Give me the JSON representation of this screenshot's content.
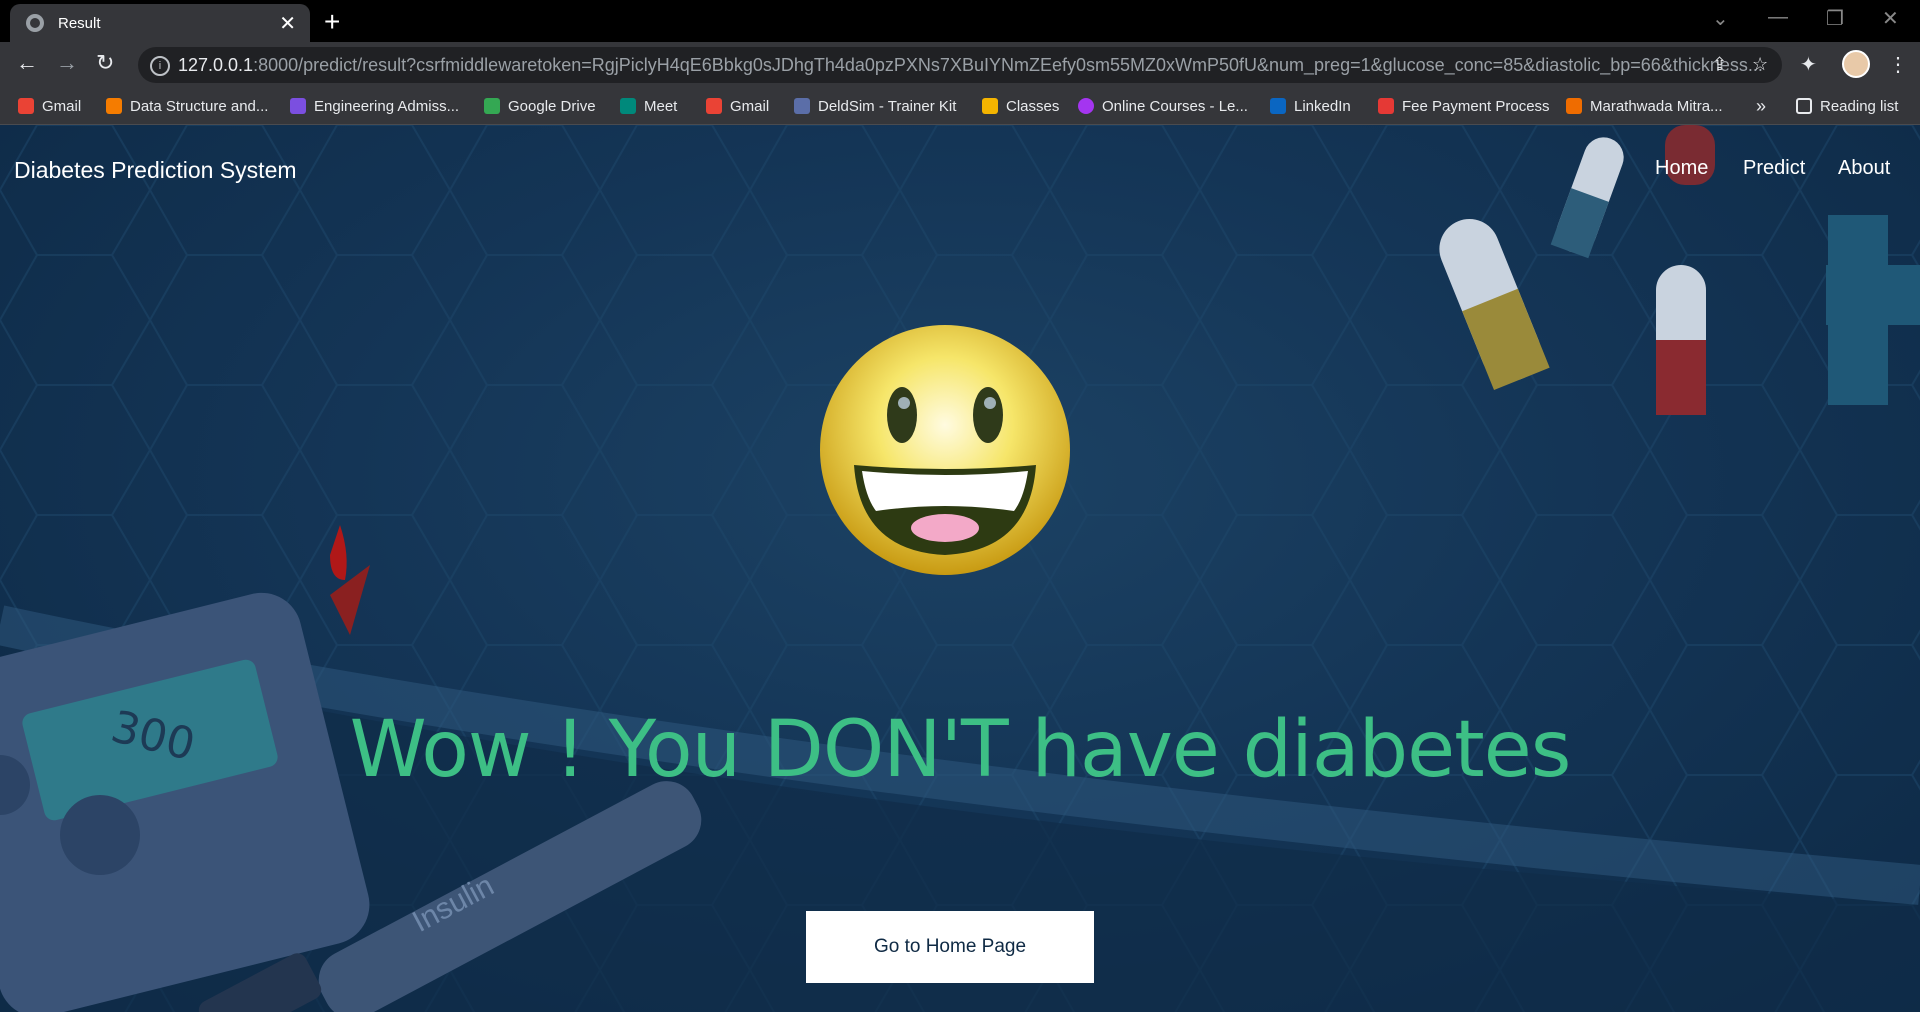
{
  "browser": {
    "tab_title": "Result",
    "url_host": "127.0.0.1",
    "url_path": ":8000/predict/result?csrfmiddlewaretoken=RgjPiclyH4qE6Bbkg0sJDhgTh4da0pzPXNs7XBuIYNmZEefy0sm55MZ0xWmP50fU&num_preg=1&glucose_conc=85&diastolic_bp=66&thickness...",
    "new_tab_symbol": "+",
    "close_symbol": "✕"
  },
  "bookmarks": [
    {
      "label": "Gmail",
      "icon": "gmail-icon",
      "color": "#ea4335"
    },
    {
      "label": "Data Structure and...",
      "icon": "blogger-icon",
      "color": "#f57c00"
    },
    {
      "label": "Engineering Admiss...",
      "icon": "list-icon",
      "color": "#7b4fe0"
    },
    {
      "label": "Google Drive",
      "icon": "drive-icon",
      "color": "#34a853"
    },
    {
      "label": "Meet",
      "icon": "meet-icon",
      "color": "#00897b"
    },
    {
      "label": "Gmail",
      "icon": "gmail-icon",
      "color": "#ea4335"
    },
    {
      "label": "DeldSim - Trainer Kit",
      "icon": "deldsim-icon",
      "color": "#5b6ea8"
    },
    {
      "label": "Classes",
      "icon": "classroom-icon",
      "color": "#f4b400"
    },
    {
      "label": "Online Courses - Le...",
      "icon": "udemy-icon",
      "color": "#a435f0"
    },
    {
      "label": "LinkedIn",
      "icon": "linkedin-icon",
      "color": "#0a66c2"
    },
    {
      "label": "Fee Payment Process",
      "icon": "document-icon",
      "color": "#e53935"
    },
    {
      "label": "Marathwada Mitra...",
      "icon": "mitra-icon",
      "color": "#ef6c00"
    }
  ],
  "bookmarks_overflow": "»",
  "reading_list": "Reading list",
  "page": {
    "brand": "Diabetes Prediction System",
    "nav": [
      "Home",
      "Predict",
      "About"
    ],
    "headline": "Wow ! You DON'T have diabetes",
    "button": "Go to Home Page",
    "meter_value": "300",
    "insulin_label": "Insulin"
  },
  "colors": {
    "headline": "#3dbf85",
    "background": "#143556",
    "button_bg": "#ffffff"
  }
}
